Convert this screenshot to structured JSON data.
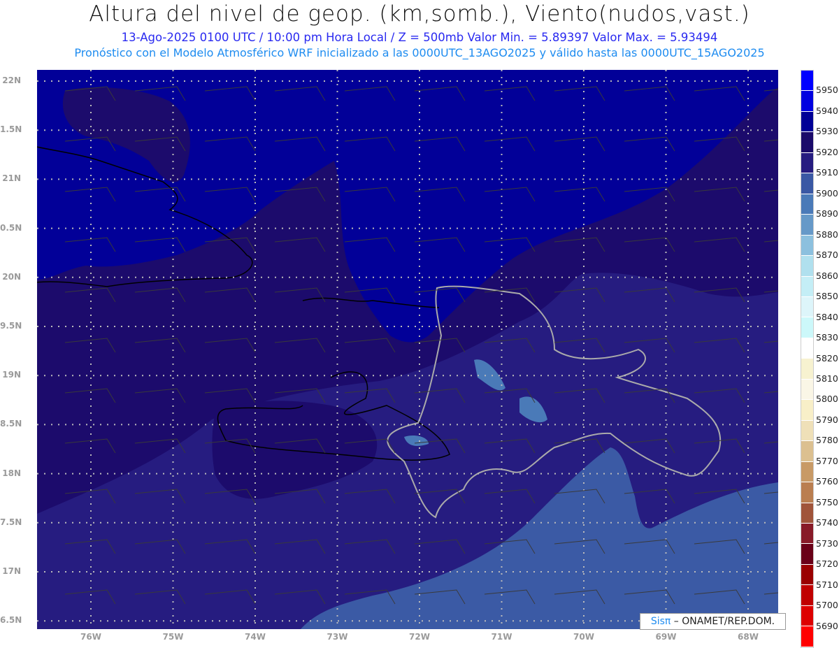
{
  "header": {
    "title": "Altura del nivel de geop. (km,somb.), Viento(nudos,vast.)",
    "subtitle1": "13-Ago-2025  0100 UTC / 10:00 pm Hora Local / Z = 500mb    Valor Min. = 5.89397  Valor Max. = 5.93494",
    "subtitle2": "Pronóstico con el Modelo Atmosférico WRF inicializado a las 0000UTC_13AGO2025 y válido hasta las  0000UTC_15AGO2025"
  },
  "chart_data": {
    "type": "heatmap",
    "title": "Altura del nivel de geop. (km,somb.), Viento(nudos,vast.)",
    "variable": "500mb geopotential height",
    "value_min": 5.89397,
    "value_max": 5.93494,
    "x_ticks": [
      "76W",
      "75W",
      "74W",
      "73W",
      "72W",
      "71W",
      "70W",
      "69W",
      "68W"
    ],
    "y_ticks": [
      "22N",
      "1.5N",
      "21N",
      "0.5N",
      "20N",
      "9.5N",
      "19N",
      "8.5N",
      "18N",
      "7.5N",
      "17N",
      "6.5N"
    ],
    "xlim": [
      -76.65,
      -67.6
    ],
    "ylim": [
      16.4,
      22.1
    ],
    "regions": [
      {
        "level": "5920-5930",
        "color": "#1c0b6c",
        "note": "background"
      },
      {
        "level": "5930-5940",
        "color": "#020098"
      },
      {
        "level": "5910-5920",
        "color": "#261c80"
      },
      {
        "level": "5900-5910",
        "color": "#3b5aa5"
      },
      {
        "level": "5890-5900",
        "color": "#4a7ab8"
      }
    ],
    "colorbar": {
      "labels": [
        "5950",
        "5940",
        "5930",
        "5920",
        "5910",
        "5900",
        "5890",
        "5880",
        "5870",
        "5860",
        "5850",
        "5840",
        "5830",
        "5820",
        "5810",
        "5800",
        "5790",
        "5780",
        "5770",
        "5760",
        "5750",
        "5740",
        "5730",
        "5720",
        "5710",
        "5700",
        "5690"
      ],
      "colors": [
        "#0000ff",
        "#0000e0",
        "#000096",
        "#1a0a6a",
        "#261c80",
        "#3a58a4",
        "#4a7ab8",
        "#6699c8",
        "#8cc0de",
        "#b0e0ee",
        "#c4eef6",
        "#ddf5fa",
        "#ccf8fa",
        "#ffffff",
        "#f7f2d0",
        "#faf6e6",
        "#f8efc8",
        "#efe0b8",
        "#dcc090",
        "#c89a66",
        "#ba7e50",
        "#a0543a",
        "#881a28",
        "#6a0018",
        "#9a0000",
        "#c00000",
        "#dd0000",
        "#ff0000"
      ]
    }
  },
  "logo": {
    "sis": "Sisπ",
    "text": " – ONAMET/REP.DOM."
  }
}
